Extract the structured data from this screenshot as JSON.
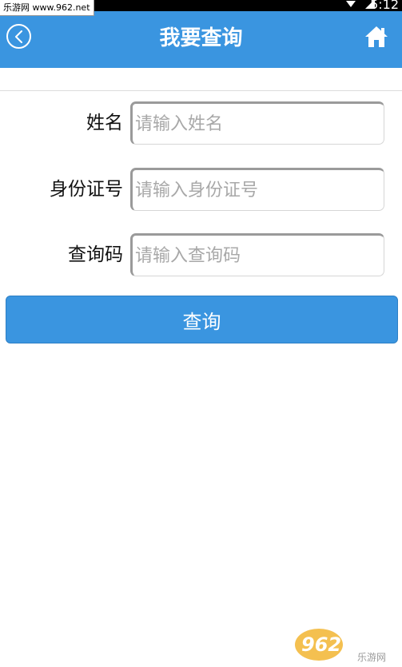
{
  "watermark": {
    "top_left": "乐游网 www.962.net",
    "bottom_right_text": "962.NET",
    "bottom_right_sub": "乐游网"
  },
  "status_bar": {
    "time": "5:12"
  },
  "header": {
    "title": "我要查询",
    "back_icon": "chevron-left-circle-icon",
    "home_icon": "home-icon",
    "color": "#3A95E0"
  },
  "form": {
    "fields": [
      {
        "label": "姓名",
        "placeholder": "请输入姓名",
        "value": ""
      },
      {
        "label": "身份证号",
        "placeholder": "请输入身份证号",
        "value": ""
      },
      {
        "label": "查询码",
        "placeholder": "请输入查询码",
        "value": ""
      }
    ],
    "submit_label": "查询"
  }
}
